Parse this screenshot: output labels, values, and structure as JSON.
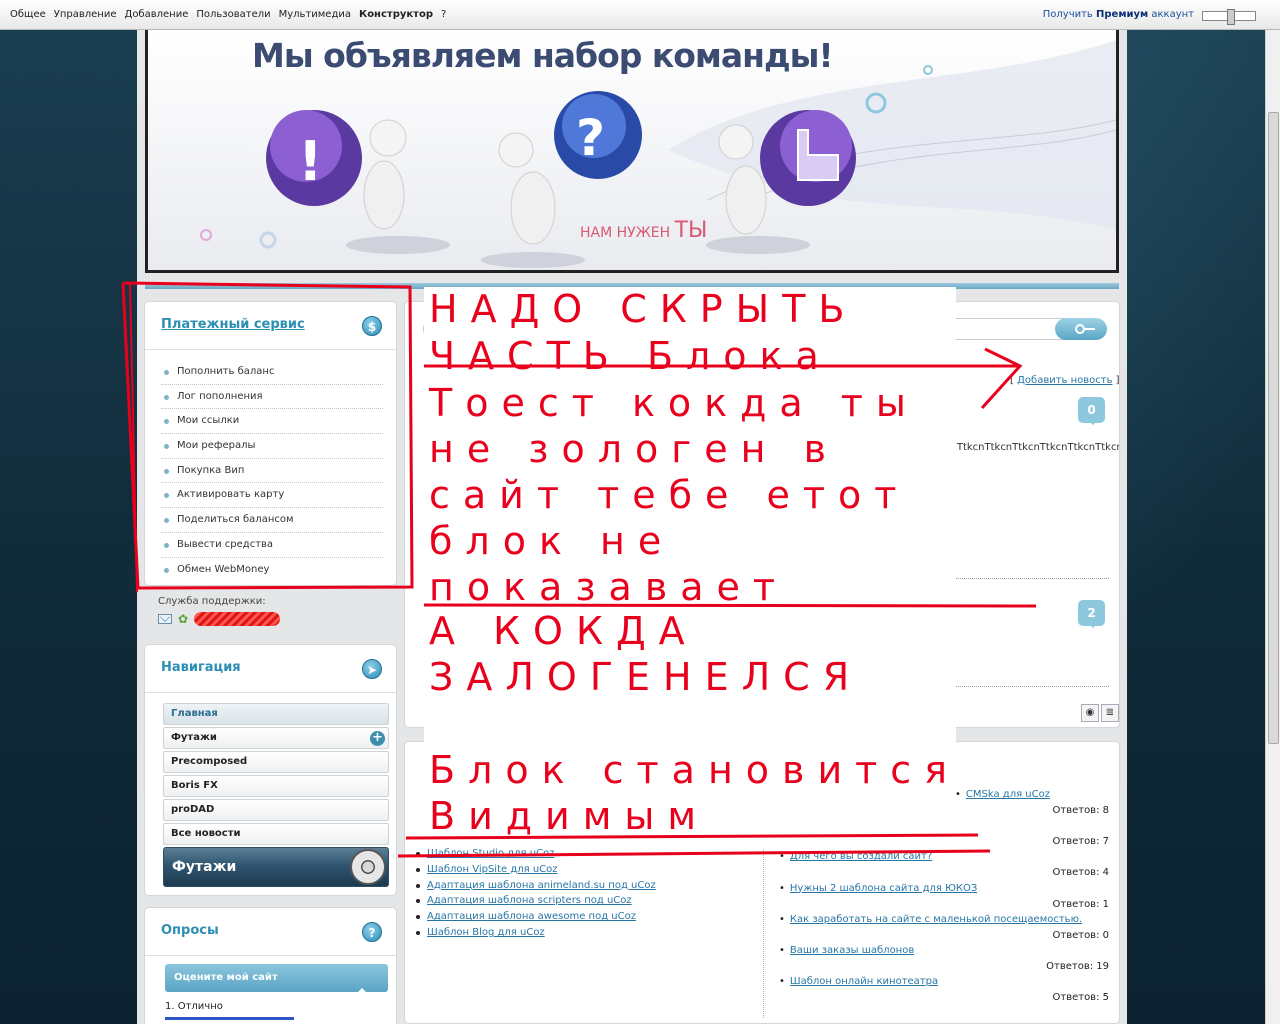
{
  "topbar": {
    "menu": [
      "Общее",
      "Управление",
      "Добавление",
      "Пользователи",
      "Мультимедиа",
      "Конструктор",
      "?"
    ],
    "active_index": 5,
    "premium_prefix": "Получить ",
    "premium_bold": "Премиум",
    "premium_suffix": " аккаунт"
  },
  "banner": {
    "title": "Мы объявляем набор команды!",
    "sub_small": "НАМ НУЖЕН ",
    "sub_big": "ТЫ"
  },
  "payment": {
    "title": "Платежный сервис",
    "icon": "dollar-icon",
    "items": [
      "Пополнить баланс",
      "Лог пополнения",
      "Мои ссылки",
      "Мои рефералы",
      "Покупка Вип",
      "Активировать карту",
      "Поделиться балансом",
      "Вывести средства",
      "Обмен WebMoney"
    ],
    "support_label": "Служба поддержки:"
  },
  "navigation": {
    "title": "Навигация",
    "icon": "cursor-icon",
    "items": [
      "Главная",
      "Футажи",
      "Precomposed",
      "Boris FX",
      "proDAD",
      "Все новости"
    ],
    "feature": "Футажи"
  },
  "polls": {
    "title": "Опросы",
    "question": "Оцените мой сайт",
    "option1": "1. Отлично",
    "option1_share": 0.58
  },
  "news": {
    "add_prefix": "[ ",
    "add_link": "Добавить новость",
    "add_suffix": " ]",
    "comment_counts": [
      "0",
      "2"
    ],
    "junk": "cnTtkcnTtkcnTtkcnTtkcnTtkcnTtkcnTt"
  },
  "forum": {
    "left_links": [
      "Шаблон Studio для uCoz",
      "Шаблон VipSite для uCoz",
      "Адаптация шаблона animeland.su под uCoz",
      "Адаптация шаблона scripters под uCoz",
      "Адаптация шаблона awesome под uCoz",
      "Шаблон Blog для uCoz"
    ],
    "right_topics": [
      {
        "title": "CMSka для uCoz",
        "answers": "Ответов: 8"
      },
      {
        "title": "",
        "answers": "Ответов: 7"
      },
      {
        "title": "Для чего вы создали сайт?",
        "answers": "Ответов: 4"
      },
      {
        "title": "Нужны 2 шаблона сайта для ЮКОЗ",
        "answers": "Ответов: 1"
      },
      {
        "title": "Как заработать на сайте с маленькой посещаемостью.",
        "answers": "Ответов: 0"
      },
      {
        "title": "Ваши заказы шаблонов",
        "answers": "Ответов: 19"
      },
      {
        "title": "Шаблон онлайн кинотеатра",
        "answers": "Ответов: 5"
      }
    ]
  },
  "annotation": {
    "lines": [
      "НАДО СКРЫТЬ",
      "ЧАСТЬ Блока",
      "Тоест кокда ты",
      "не зологен в",
      "сайт тебе етот",
      "блок не",
      "показавает",
      "А КОКДА",
      "ЗАЛОГЕНЕЛСЯ",
      "Блок становится",
      "Видимым"
    ],
    "color": "#e8001c"
  }
}
